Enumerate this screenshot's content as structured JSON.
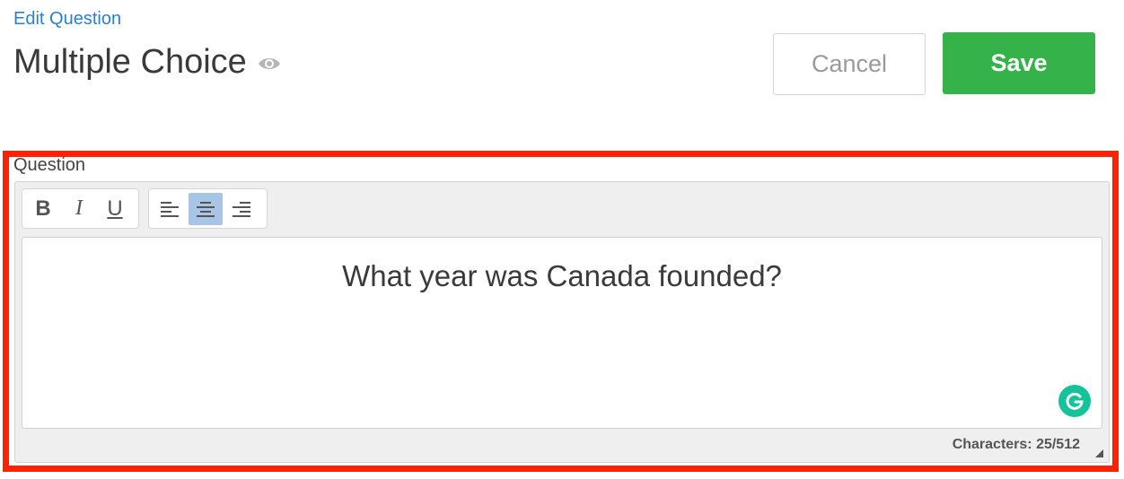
{
  "header": {
    "breadcrumb": "Edit Question",
    "title": "Multiple Choice",
    "preview_icon": "eye-icon"
  },
  "actions": {
    "cancel_label": "Cancel",
    "save_label": "Save"
  },
  "question_field": {
    "label": "Question",
    "toolbar": {
      "format_buttons": [
        {
          "name": "bold",
          "glyph": "B"
        },
        {
          "name": "italic",
          "glyph": "I"
        },
        {
          "name": "underline",
          "glyph": "U"
        }
      ],
      "align_buttons": [
        {
          "name": "align-left",
          "active": false
        },
        {
          "name": "align-center",
          "active": true
        },
        {
          "name": "align-right",
          "active": false
        }
      ]
    },
    "value": "What year was Canada founded?",
    "character_count": "Characters: 25/512",
    "grammarly_icon": "grammarly-icon"
  },
  "colors": {
    "link": "#2a7fd4",
    "save": "#35b34a",
    "highlight": "#ff2200",
    "active_toolbar": "#a9c5e6",
    "grammarly": "#15c39a"
  }
}
